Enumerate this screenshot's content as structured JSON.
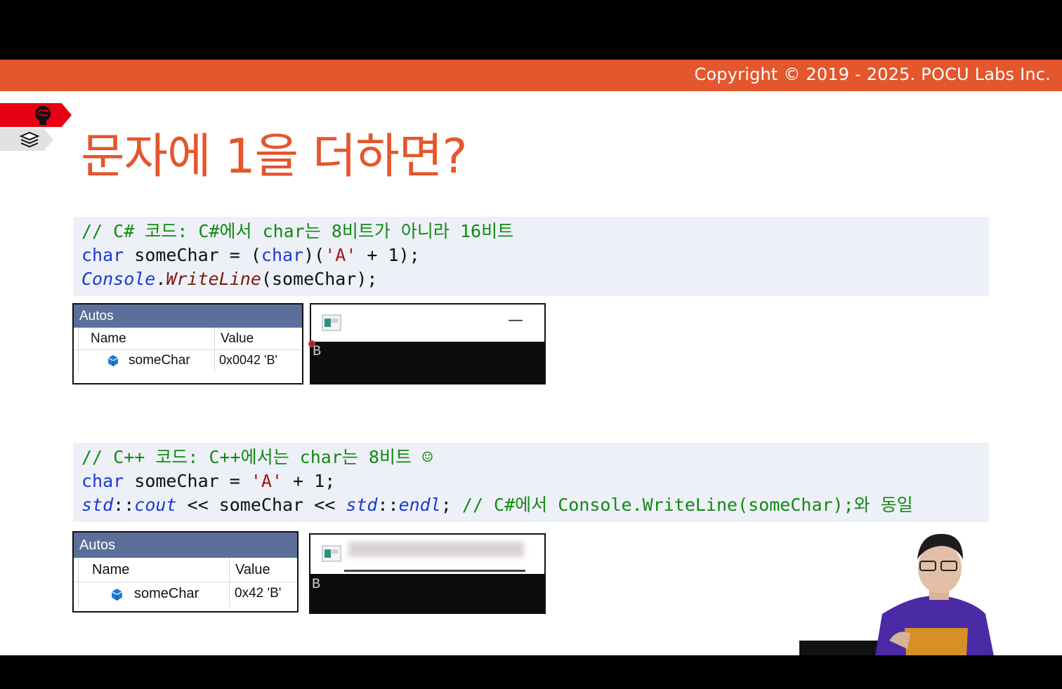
{
  "header": {
    "copyright": "Copyright © 2019 - 2025. POCU Labs Inc."
  },
  "slide": {
    "title": "문자에 1을 더하면?"
  },
  "csharp": {
    "code": {
      "line1": "// C# 코드: C#에서 char는 8비트가 아니라 16비트",
      "line2": {
        "kw": "char",
        "sp1": " someChar = (",
        "kw2": "char",
        "sp2": ")(",
        "str": "'A'",
        "rest": " + 1);"
      },
      "line3": {
        "type": "Console",
        "dot": ".",
        "method": "WriteLine",
        "rest": "(someChar);"
      }
    },
    "autos": {
      "title": "Autos",
      "col_name": "Name",
      "col_value": "Value",
      "row_name": "someChar",
      "row_value": "0x0042 'B'"
    },
    "console": {
      "minimize": "—",
      "output": "B"
    }
  },
  "cpp": {
    "code": {
      "line1": "// C++ 코드: C++에서는 char는 8비트 ☺",
      "line2": {
        "kw": "char",
        "mid": " someChar = ",
        "str": "'A'",
        "rest": " + 1;"
      },
      "line3": {
        "ns1": "std",
        "sep1": "::",
        "fn1": "cout",
        "mid": " << someChar << ",
        "ns2": "std",
        "sep2": "::",
        "fn2": "endl",
        "semi": "; ",
        "comment": "// C#에서 Console.WriteLine(someChar);와 동일"
      }
    },
    "autos": {
      "title": "Autos",
      "col_name": "Name",
      "col_value": "Value",
      "row_name": "someChar",
      "row_value": "0x42 'B'"
    },
    "console": {
      "output": "B"
    }
  },
  "icons": {
    "brain": "brain-icon",
    "layers": "layers-icon",
    "object": "object-cube-icon",
    "console_app": "console-app-icon"
  },
  "colors": {
    "accent": "#e4562c",
    "tab_red": "#e60012",
    "code_bg": "#eef0f8",
    "comment": "#118a11",
    "keyword": "#1a3ad0",
    "string": "#a31515",
    "autos_header": "#5b6f9a"
  }
}
